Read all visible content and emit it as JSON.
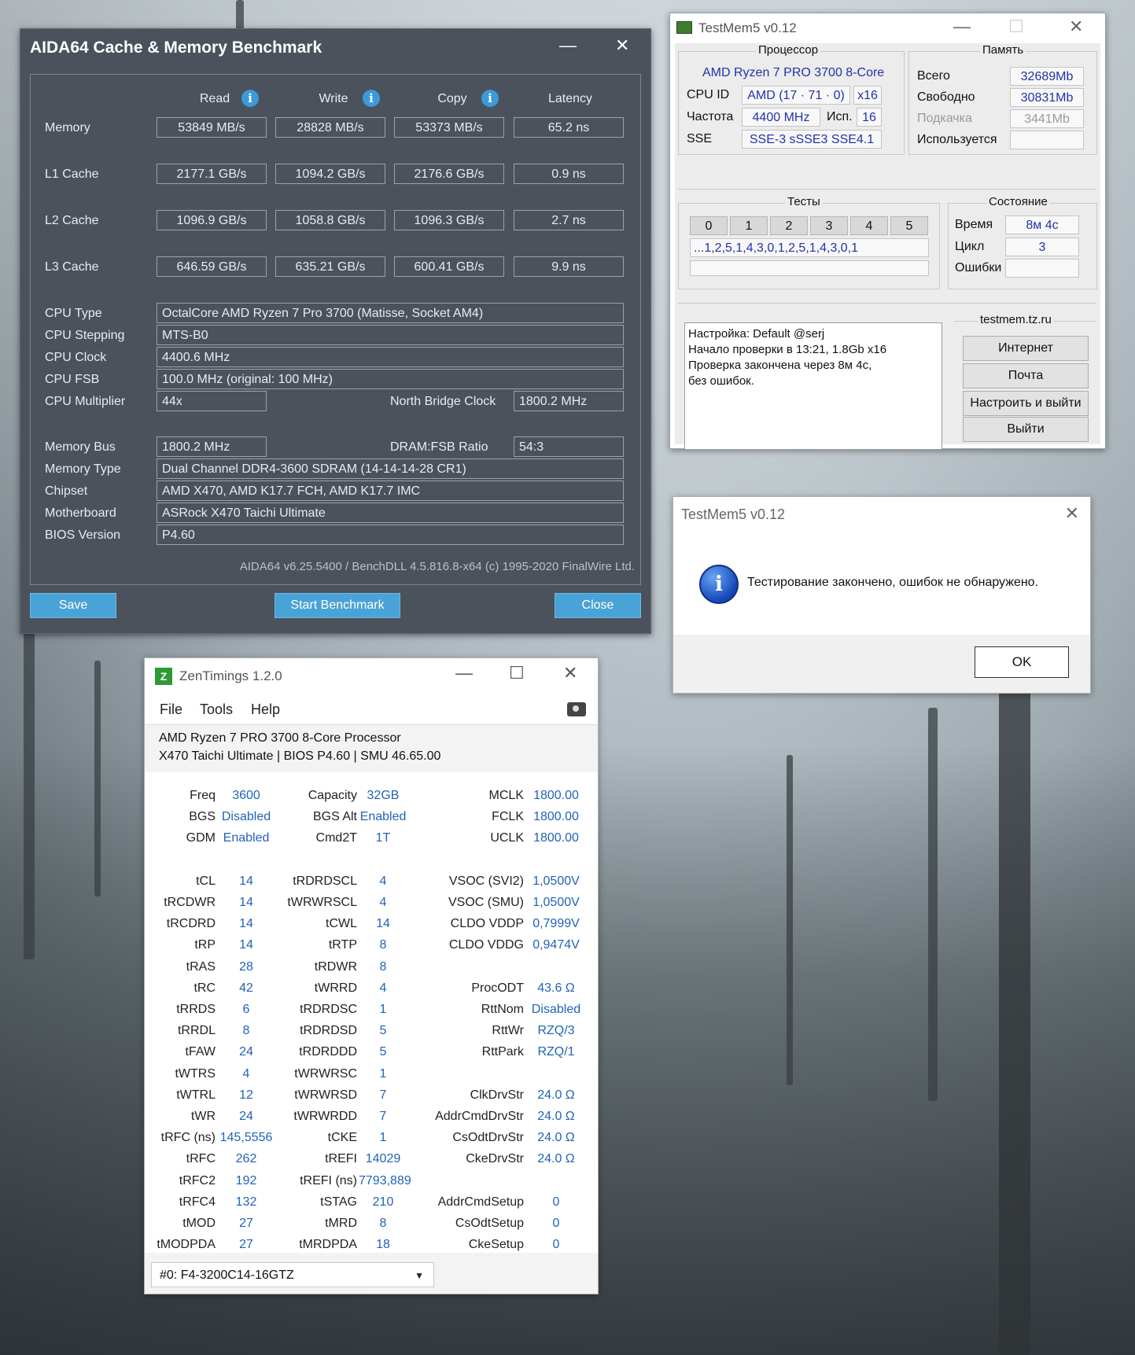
{
  "aida": {
    "title": "AIDA64 Cache & Memory Benchmark",
    "minimize": "—",
    "close_x": "✕",
    "headers": {
      "read": "Read",
      "write": "Write",
      "copy": "Copy",
      "latency": "Latency"
    },
    "rows": [
      {
        "label": "Memory",
        "read": "53849 MB/s",
        "write": "28828 MB/s",
        "copy": "53373 MB/s",
        "latency": "65.2 ns"
      },
      {
        "label": "L1 Cache",
        "read": "2177.1 GB/s",
        "write": "1094.2 GB/s",
        "copy": "2176.6 GB/s",
        "latency": "0.9 ns"
      },
      {
        "label": "L2 Cache",
        "read": "1096.9 GB/s",
        "write": "1058.8 GB/s",
        "copy": "1096.3 GB/s",
        "latency": "2.7 ns"
      },
      {
        "label": "L3 Cache",
        "read": "646.59 GB/s",
        "write": "635.21 GB/s",
        "copy": "600.41 GB/s",
        "latency": "9.9 ns"
      }
    ],
    "info": {
      "cpu_type_label": "CPU Type",
      "cpu_type": "OctalCore AMD Ryzen 7 Pro 3700  (Matisse, Socket AM4)",
      "cpu_stepping_label": "CPU Stepping",
      "cpu_stepping": "MTS-B0",
      "cpu_clock_label": "CPU Clock",
      "cpu_clock": "4400.6 MHz",
      "cpu_fsb_label": "CPU FSB",
      "cpu_fsb": "100.0 MHz  (original: 100 MHz)",
      "cpu_mult_label": "CPU Multiplier",
      "cpu_mult": "44x",
      "nb_clock_label": "North Bridge Clock",
      "nb_clock": "1800.2 MHz",
      "mem_bus_label": "Memory Bus",
      "mem_bus": "1800.2 MHz",
      "dram_ratio_label": "DRAM:FSB Ratio",
      "dram_ratio": "54:3",
      "mem_type_label": "Memory Type",
      "mem_type": "Dual Channel DDR4-3600 SDRAM  (14-14-14-28 CR1)",
      "chipset_label": "Chipset",
      "chipset": "AMD X470, AMD K17.7 FCH, AMD K17.7 IMC",
      "mobo_label": "Motherboard",
      "mobo": "ASRock X470 Taichi Ultimate",
      "bios_label": "BIOS Version",
      "bios": "P4.60"
    },
    "footer": "AIDA64 v6.25.5400 / BenchDLL 4.5.816.8-x64  (c) 1995-2020 FinalWire Ltd.",
    "buttons": {
      "save": "Save",
      "start": "Start Benchmark",
      "close": "Close"
    },
    "colors": {
      "bg": "#4b525b",
      "button": "#4aa3d6"
    }
  },
  "tm5": {
    "title": "TestMem5 v0.12",
    "min": "—",
    "max": "☐",
    "close": "✕",
    "proc_group": "Процессор",
    "proc_name": "AMD Ryzen 7 PRO 3700 8-Core",
    "cpuid_label": "CPU ID",
    "cpuid": "AMD  (17 · 71 · 0)",
    "cpuid_x": "x16",
    "freq_label": "Частота",
    "freq": "4400 MHz",
    "use_label": "Исп.",
    "use": "16",
    "sse_label": "SSE",
    "sse": "SSE-3 sSSE3 SSE4.1",
    "mem_group": "Память",
    "total_label": "Всего",
    "total": "32689Mb",
    "free_label": "Свободно",
    "free": "30831Mb",
    "swap_label": "Подкачка",
    "swap": "3441Mb",
    "used_label": "Используется",
    "used": "",
    "tests_group": "Тесты",
    "test_nums": [
      "0",
      "1",
      "2",
      "3",
      "4",
      "5"
    ],
    "test_seq": "...1,2,5,1,4,3,0,1,2,5,1,4,3,0,1",
    "state_group": "Состояние",
    "time_label": "Время",
    "time": "8м 4с",
    "cycle_label": "Цикл",
    "cycle": "3",
    "errors_label": "Ошибки",
    "errors": "",
    "log": [
      "Настройка: Default @serj",
      "Начало проверки в 13:21, 1.8Gb x16",
      "Проверка закончена через 8м 4с,",
      "без ошибок."
    ],
    "site_group": "testmem.tz.ru",
    "btn_internet": "Интернет",
    "btn_mail": "Почта",
    "btn_config": "Настроить и выйти",
    "btn_exit": "Выйти"
  },
  "dialog": {
    "title": "TestMem5 v0.12",
    "close": "✕",
    "icon": "i",
    "message": "Тестирование закончено, ошибок не обнаружено.",
    "ok": "OK"
  },
  "zen": {
    "title": "ZenTimings 1.2.0",
    "min": "—",
    "max": "☐",
    "close": "✕",
    "icon": "Z",
    "menu": [
      "File",
      "Tools",
      "Help"
    ],
    "cpu": "AMD Ryzen 7 PRO 3700 8-Core Processor",
    "board": "X470 Taichi Ultimate | BIOS P4.60 | SMU 46.65.00",
    "col1": [
      [
        "Freq",
        "3600"
      ],
      [
        "BGS",
        "Disabled"
      ],
      [
        "GDM",
        "Enabled"
      ],
      [
        "",
        ""
      ],
      [
        "tCL",
        "14"
      ],
      [
        "tRCDWR",
        "14"
      ],
      [
        "tRCDRD",
        "14"
      ],
      [
        "tRP",
        "14"
      ],
      [
        "tRAS",
        "28"
      ],
      [
        "tRC",
        "42"
      ],
      [
        "tRRDS",
        "6"
      ],
      [
        "tRRDL",
        "8"
      ],
      [
        "tFAW",
        "24"
      ],
      [
        "tWTRS",
        "4"
      ],
      [
        "tWTRL",
        "12"
      ],
      [
        "tWR",
        "24"
      ],
      [
        "tRFC (ns)",
        "145,5556"
      ],
      [
        "tRFC",
        "262"
      ],
      [
        "tRFC2",
        "192"
      ],
      [
        "tRFC4",
        "132"
      ],
      [
        "tMOD",
        "27"
      ],
      [
        "tMODPDA",
        "27"
      ]
    ],
    "col2": [
      [
        "Capacity",
        "32GB"
      ],
      [
        "BGS Alt",
        "Enabled"
      ],
      [
        "Cmd2T",
        "1T"
      ],
      [
        "",
        ""
      ],
      [
        "tRDRDSCL",
        "4"
      ],
      [
        "tWRWRSCL",
        "4"
      ],
      [
        "tCWL",
        "14"
      ],
      [
        "tRTP",
        "8"
      ],
      [
        "tRDWR",
        "8"
      ],
      [
        "tWRRD",
        "4"
      ],
      [
        "tRDRDSC",
        "1"
      ],
      [
        "tRDRDSD",
        "5"
      ],
      [
        "tRDRDDD",
        "5"
      ],
      [
        "tWRWRSC",
        "1"
      ],
      [
        "tWRWRSD",
        "7"
      ],
      [
        "tWRWRDD",
        "7"
      ],
      [
        "tCKE",
        "1"
      ],
      [
        "tREFI",
        "14029"
      ],
      [
        "tREFI (ns)",
        "7793,889"
      ],
      [
        "tSTAG",
        "210"
      ],
      [
        "tMRD",
        "8"
      ],
      [
        "tMRDPDA",
        "18"
      ]
    ],
    "col3": [
      [
        "MCLK",
        "1800.00"
      ],
      [
        "FCLK",
        "1800.00"
      ],
      [
        "UCLK",
        "1800.00"
      ],
      [
        "",
        ""
      ],
      [
        "VSOC (SVI2)",
        "1,0500V"
      ],
      [
        "VSOC (SMU)",
        "1,0500V"
      ],
      [
        "CLDO VDDP",
        "0,7999V"
      ],
      [
        "CLDO VDDG",
        "0,9474V"
      ],
      [
        "",
        ""
      ],
      [
        "ProcODT",
        "43.6 Ω"
      ],
      [
        "RttNom",
        "Disabled"
      ],
      [
        "RttWr",
        "RZQ/3"
      ],
      [
        "RttPark",
        "RZQ/1"
      ],
      [
        "",
        ""
      ],
      [
        "ClkDrvStr",
        "24.0 Ω"
      ],
      [
        "AddrCmdDrvStr",
        "24.0 Ω"
      ],
      [
        "CsOdtDrvStr",
        "24.0 Ω"
      ],
      [
        "CkeDrvStr",
        "24.0 Ω"
      ],
      [
        "",
        ""
      ],
      [
        "AddrCmdSetup",
        "0"
      ],
      [
        "CsOdtSetup",
        "0"
      ],
      [
        "CkeSetup",
        "0"
      ]
    ],
    "dimm": "#0: F4-3200C14-16GTZ",
    "caret": "▼"
  }
}
